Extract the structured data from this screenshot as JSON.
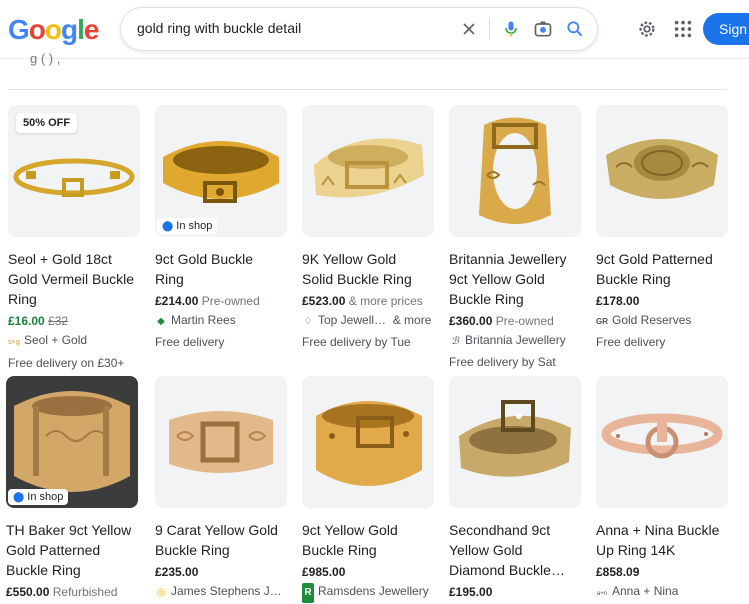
{
  "header": {
    "logo": [
      "G",
      "o",
      "o",
      "g",
      "l",
      "e"
    ],
    "logo_colors": [
      "#4285F4",
      "#EA4335",
      "#FBBC05",
      "#4285F4",
      "#34A853",
      "#EA4335"
    ],
    "search_value": "gold ring with buckle detail",
    "sign_in_label": "Sign in",
    "cutoff_text": "g (  )  ,"
  },
  "colors": {
    "accent": "#1a73e8",
    "sale_green": "#188038"
  },
  "products": [
    {
      "badge": "50% OFF",
      "in_shop": "",
      "title": [
        "Seol + Gold 18ct",
        "Gold Vermeil Buckle",
        "Ring"
      ],
      "price": "£16.00",
      "old_price": "£32",
      "condition": "",
      "price_extra": "",
      "sale": true,
      "seller_icon": "seol-gold-logo-icon",
      "seller": "Seol + Gold",
      "seller_glyph": "s+g",
      "extra": "",
      "delivery": "Free delivery on £30+"
    },
    {
      "badge": "",
      "in_shop": "In shop",
      "title": [
        "9ct Gold Buckle",
        "Ring"
      ],
      "price": "£214.00",
      "old_price": "",
      "condition": "Pre-owned",
      "price_extra": "",
      "sale": false,
      "seller_icon": "martin-rees-diamond-icon",
      "seller": "Martin Rees",
      "seller_glyph": "◆",
      "extra": "",
      "delivery": "Free delivery"
    },
    {
      "badge": "",
      "in_shop": "",
      "title": [
        "9K Yellow Gold",
        "Solid Buckle Ring"
      ],
      "price": "£523.00",
      "old_price": "",
      "condition": "",
      "price_extra": "& more prices",
      "sale": false,
      "seller_icon": "top-jewellery-diamond-icon",
      "seller": "Top Jewell…",
      "seller_glyph": "♢",
      "extra": "& more",
      "delivery": "Free delivery by Tue"
    },
    {
      "badge": "",
      "in_shop": "",
      "title": [
        "Britannia Jewellery",
        "9ct Yellow Gold",
        "Buckle Ring"
      ],
      "price": "£360.00",
      "old_price": "",
      "condition": "Pre-owned",
      "price_extra": "",
      "sale": false,
      "seller_icon": "britannia-logo-icon",
      "seller": "Britannia Jewellery",
      "seller_glyph": "ℬ",
      "extra": "",
      "delivery": "Free delivery by Sat"
    },
    {
      "badge": "",
      "in_shop": "",
      "title": [
        "9ct Gold Patterned",
        "Buckle Ring"
      ],
      "price": "£178.00",
      "old_price": "",
      "condition": "",
      "price_extra": "",
      "sale": false,
      "seller_icon": "gold-reserves-logo-icon",
      "seller": "Gold Reserves",
      "seller_glyph": "GR",
      "extra": "",
      "delivery": "Free delivery"
    },
    {
      "badge": "",
      "in_shop": "In shop",
      "title": [
        "TH Baker 9ct Yellow",
        "Gold Patterned",
        "Buckle Ring"
      ],
      "price": "£550.00",
      "old_price": "",
      "condition": "Refurbished",
      "price_extra": "",
      "sale": false,
      "seller_icon": "",
      "seller": "",
      "seller_glyph": "",
      "extra": "",
      "delivery": ""
    },
    {
      "badge": "",
      "in_shop": "",
      "title": [
        "9 Carat Yellow Gold",
        "Buckle Ring"
      ],
      "price": "£235.00",
      "old_price": "",
      "condition": "",
      "price_extra": "",
      "sale": false,
      "seller_icon": "james-stephens-logo-icon",
      "seller": "James Stephens J…",
      "seller_glyph": "◎",
      "extra": "",
      "delivery": ""
    },
    {
      "badge": "",
      "in_shop": "",
      "title": [
        "9ct Yellow Gold",
        "Buckle Ring"
      ],
      "price": "£985.00",
      "old_price": "",
      "condition": "",
      "price_extra": "",
      "sale": false,
      "seller_icon": "ramsdens-logo-icon",
      "seller": "Ramsdens Jewellery",
      "seller_glyph": "R",
      "extra": "",
      "delivery": ""
    },
    {
      "badge": "",
      "in_shop": "",
      "title": [
        "Secondhand 9ct",
        "Yellow Gold",
        "Diamond Buckle…"
      ],
      "price": "£195.00",
      "old_price": "",
      "condition": "",
      "price_extra": "",
      "sale": false,
      "seller_icon": "",
      "seller": "",
      "seller_glyph": "",
      "extra": "",
      "delivery": ""
    },
    {
      "badge": "",
      "in_shop": "",
      "title": [
        "Anna + Nina Buckle",
        "Up Ring 14K"
      ],
      "price": "£858.09",
      "old_price": "",
      "condition": "",
      "price_extra": "",
      "sale": false,
      "seller_icon": "anna-nina-logo-icon",
      "seller": "Anna + Nina",
      "seller_glyph": "a+n",
      "extra": "",
      "delivery": ""
    }
  ]
}
